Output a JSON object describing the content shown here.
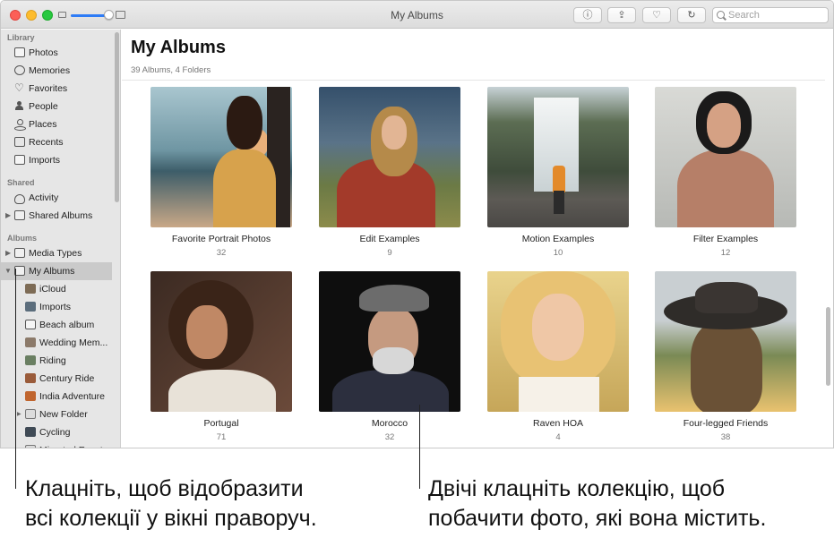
{
  "window": {
    "title": "My Albums",
    "search_placeholder": "Search",
    "toolbar": [
      {
        "name": "info-icon",
        "glyph": "ⓘ"
      },
      {
        "name": "share-icon",
        "glyph": "⇪"
      },
      {
        "name": "heart-icon",
        "glyph": "♡"
      },
      {
        "name": "rotate-icon",
        "glyph": "↻"
      }
    ],
    "zoom_level": 0.85
  },
  "sidebar": {
    "sections": {
      "library": "Library",
      "shared": "Shared",
      "albums": "Albums"
    },
    "library_items": [
      "Photos",
      "Memories",
      "Favorites",
      "People",
      "Places",
      "Recents",
      "Imports"
    ],
    "shared_items": [
      "Activity",
      "Shared Albums"
    ],
    "album_items": [
      "Media Types",
      "My Albums",
      "iCloud",
      "Imports",
      "Beach album",
      "Wedding Mem...",
      "Riding",
      "Century Ride",
      "India Adventure",
      "New Folder",
      "Cycling",
      "Migrated Events"
    ]
  },
  "main": {
    "title": "My Albums",
    "subtitle": "39 Albums, 4 Folders",
    "albums": [
      {
        "name": "Favorite Portrait Photos",
        "count": "32"
      },
      {
        "name": "Edit Examples",
        "count": "9"
      },
      {
        "name": "Motion Examples",
        "count": "10"
      },
      {
        "name": "Filter Examples",
        "count": "12"
      },
      {
        "name": "Portugal",
        "count": "71"
      },
      {
        "name": "Morocco",
        "count": "32"
      },
      {
        "name": "Raven HOA",
        "count": "4"
      },
      {
        "name": "Four-legged Friends",
        "count": "38"
      }
    ]
  },
  "captions": {
    "left_line1": "Клацніть, щоб відобразити",
    "left_line2": "всі колекції у вікні праворуч.",
    "right_line1": "Двічі клацніть колекцію, щоб",
    "right_line2": "побачити фото, які вона містить."
  }
}
